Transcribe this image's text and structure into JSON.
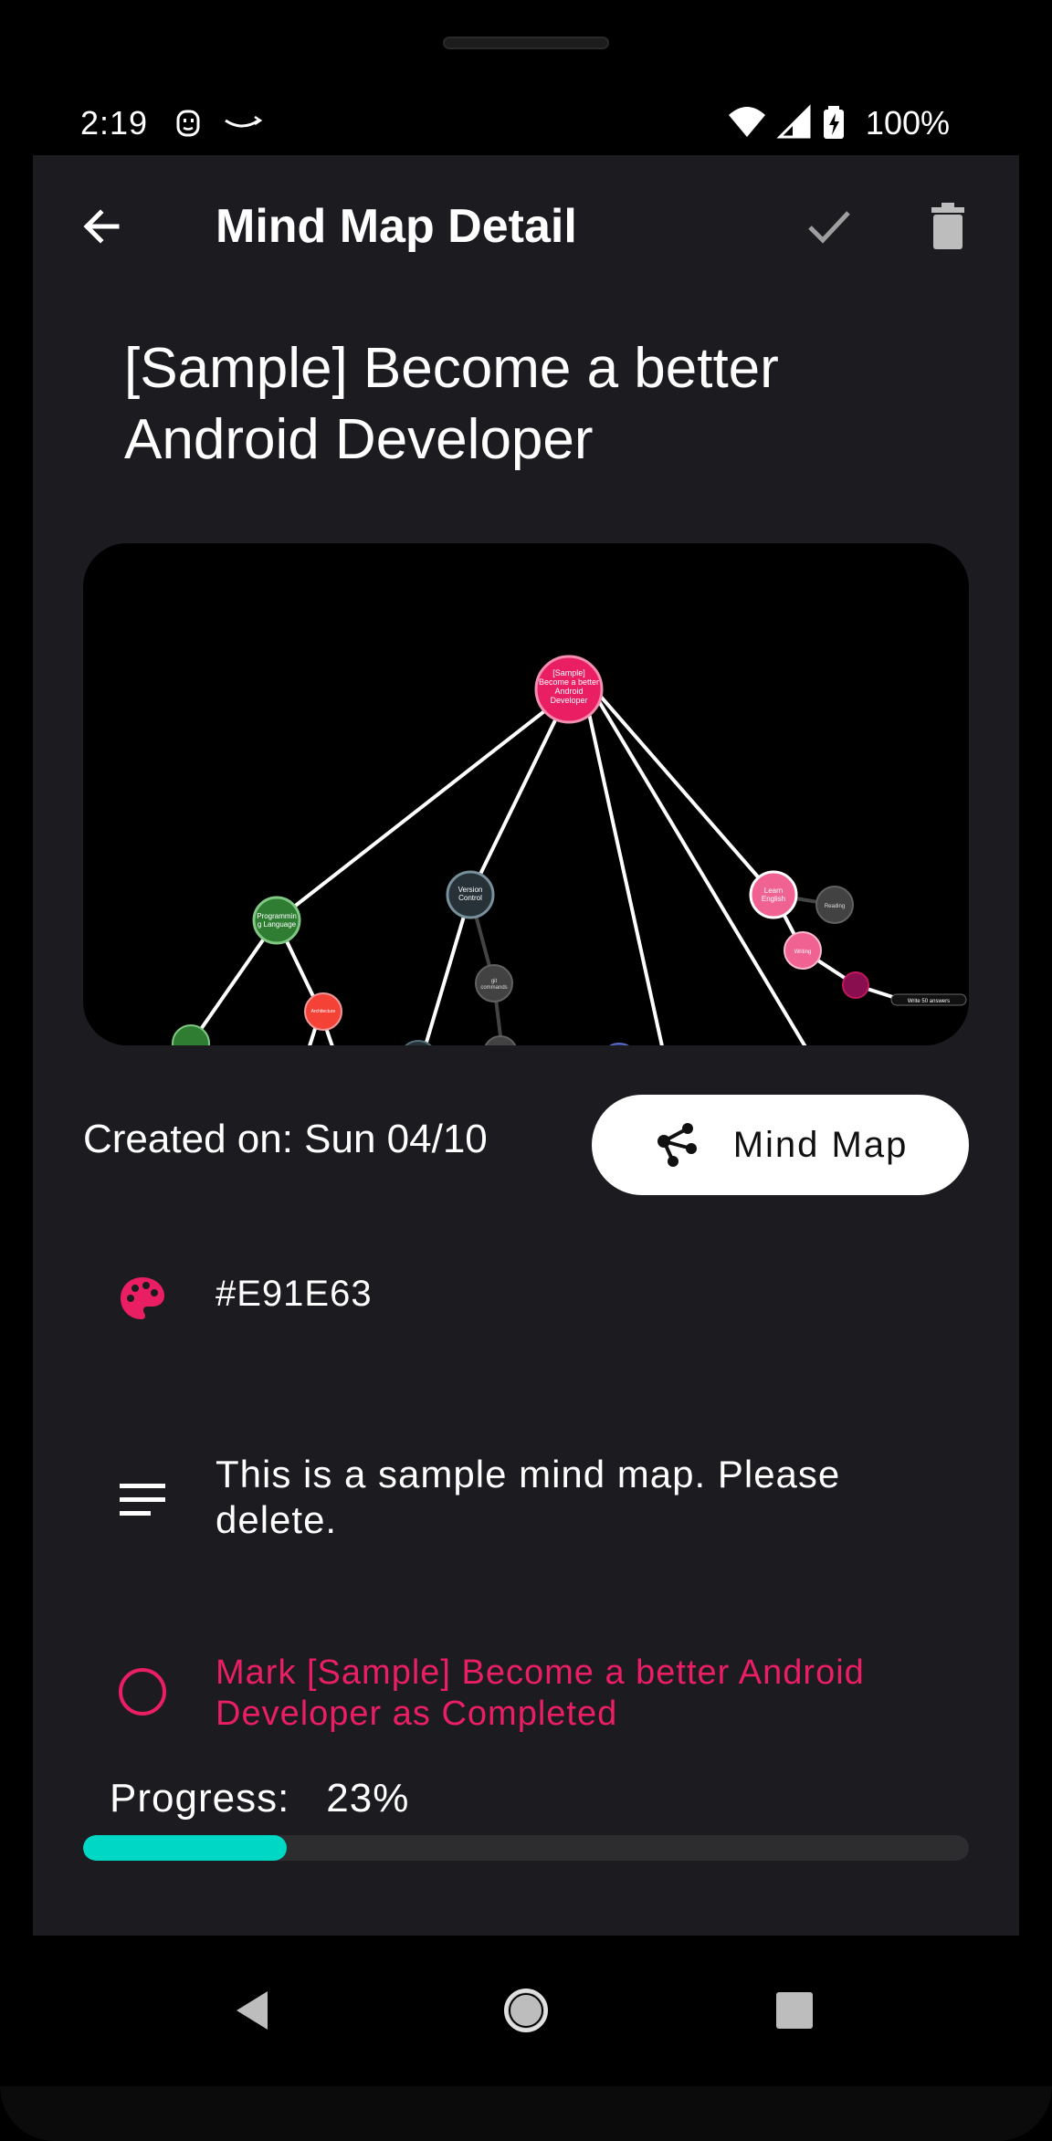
{
  "status_bar": {
    "time": "2:19",
    "battery_text": "100%"
  },
  "app_bar": {
    "title": "Mind Map Detail",
    "back_icon": "arrow-back-icon",
    "confirm_icon": "check-icon",
    "delete_icon": "trash-icon"
  },
  "detail": {
    "map_title": "[Sample] Become a better Android Developer",
    "created_label": "Created on: Sun 04/10",
    "mind_map_button": "Mind Map",
    "color_value": "#E91E63",
    "description": "This is a sample mind map. Please delete.",
    "mark_completed": "Mark [Sample] Become a better Android Developer as Completed",
    "progress_label": "Progress:",
    "progress_value": "23%",
    "progress_fraction": 0.23
  },
  "preview_nodes": {
    "root": "[Sample] Become a better Android Developer",
    "programming": "Programming Language",
    "version_control": "Version Control",
    "git": "git commands",
    "architecture": "Architecture",
    "learn_english": "Learn English",
    "reading": "Reading",
    "writing": "Writing",
    "answers": "Write 50 answers"
  },
  "colors": {
    "accent": "#E91E63",
    "progress": "#00D8C6",
    "surface": "#1C1B1F",
    "node_green": "#2E7D32",
    "node_slate": "#263238",
    "node_gray": "#424242",
    "node_red": "#F44336",
    "node_pink": "#F06292"
  }
}
